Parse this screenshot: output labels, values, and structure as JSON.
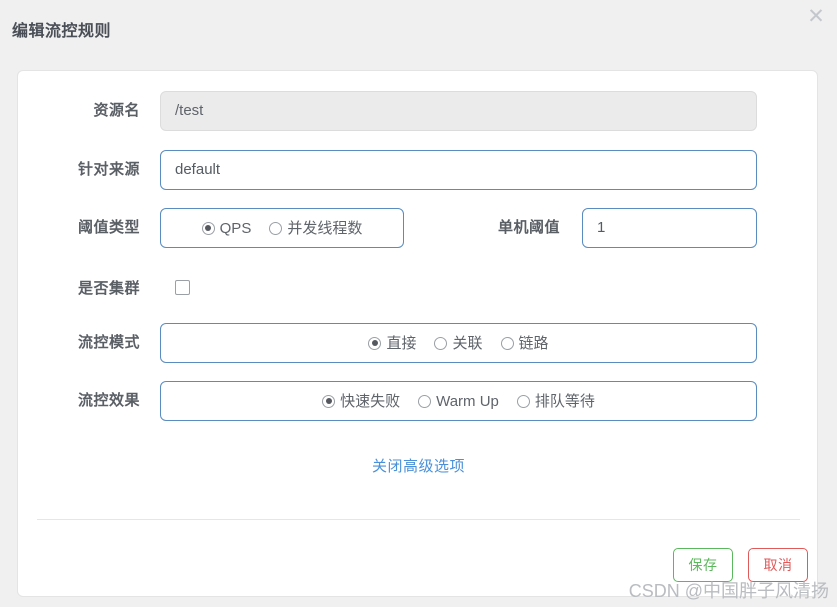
{
  "dialog": {
    "title": "编辑流控规则",
    "close_icon": "close-icon",
    "close_glyph": "✕"
  },
  "form": {
    "resource": {
      "label": "资源名",
      "value": "/test",
      "disabled": true
    },
    "origin": {
      "label": "针对来源",
      "value": "default"
    },
    "threshold_type": {
      "label": "阈值类型",
      "options": [
        {
          "label": "QPS",
          "checked": true
        },
        {
          "label": "并发线程数",
          "checked": false
        }
      ]
    },
    "single_threshold": {
      "label": "单机阈值",
      "value": "1"
    },
    "cluster": {
      "label": "是否集群",
      "checked": false
    },
    "flow_mode": {
      "label": "流控模式",
      "options": [
        {
          "label": "直接",
          "checked": true
        },
        {
          "label": "关联",
          "checked": false
        },
        {
          "label": "链路",
          "checked": false
        }
      ]
    },
    "flow_effect": {
      "label": "流控效果",
      "options": [
        {
          "label": "快速失败",
          "checked": true
        },
        {
          "label": "Warm Up",
          "checked": false
        },
        {
          "label": "排队等待",
          "checked": false
        }
      ]
    },
    "advanced_link": "关闭高级选项"
  },
  "footer": {
    "save_label": "保存",
    "cancel_label": "取消"
  },
  "watermark": "CSDN @中国胖子风清扬",
  "colors": {
    "accent_border": "#5a8cc0",
    "link": "#4a90d9",
    "save": "#5cb85c",
    "cancel": "#e05a5a",
    "page_bg": "#f0f0f0"
  }
}
